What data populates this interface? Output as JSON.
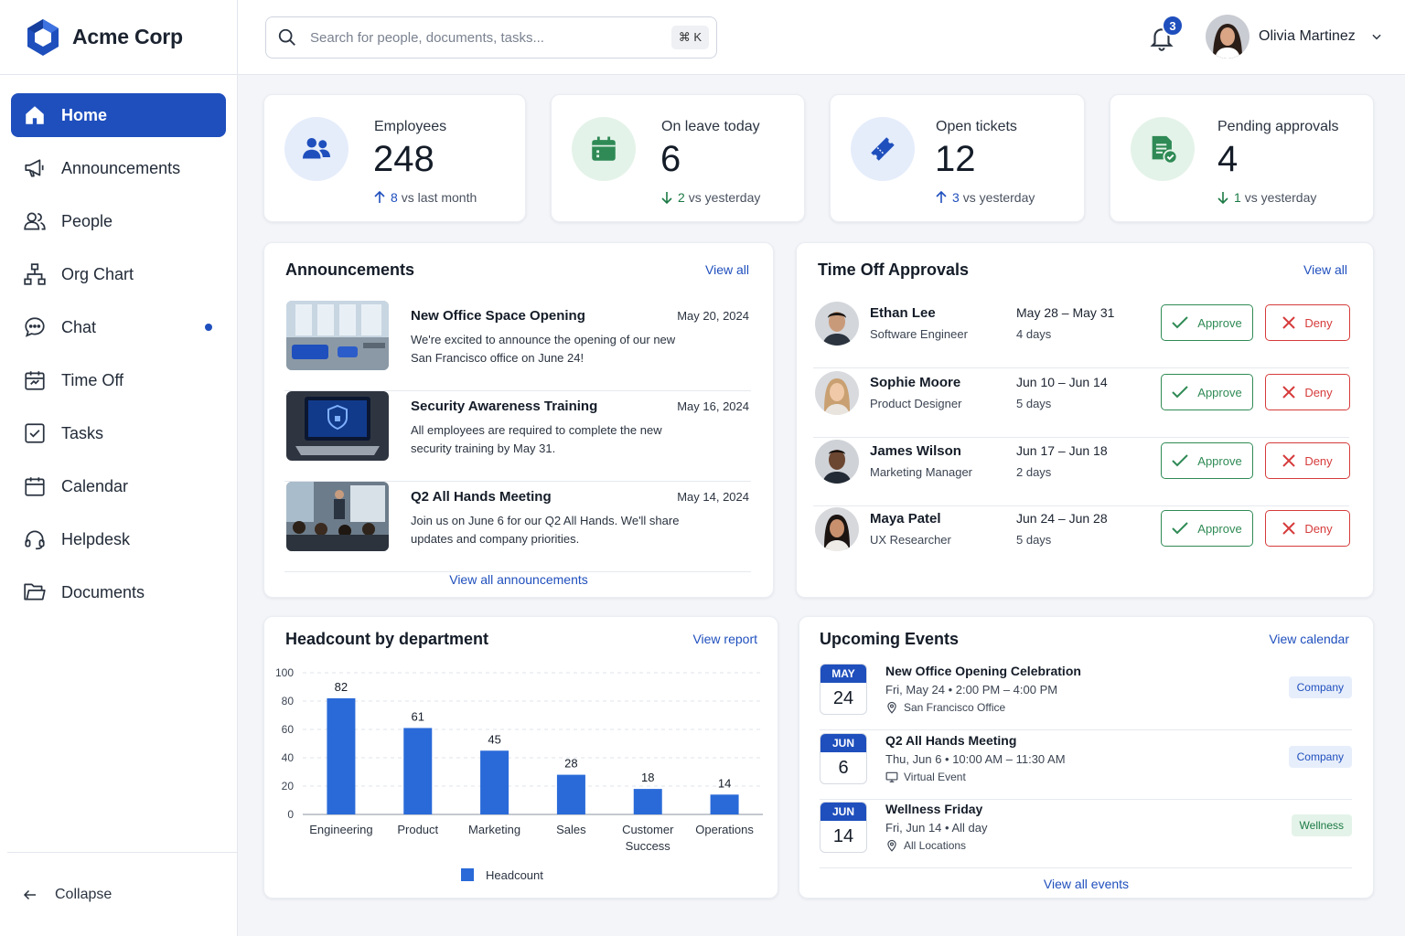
{
  "brand": {
    "name": "Acme Corp"
  },
  "nav": {
    "items": [
      {
        "label": "Home",
        "icon": "home-icon"
      },
      {
        "label": "Announcements",
        "icon": "megaphone-icon"
      },
      {
        "label": "People",
        "icon": "people-icon"
      },
      {
        "label": "Org Chart",
        "icon": "org-chart-icon"
      },
      {
        "label": "Chat",
        "icon": "chat-icon"
      },
      {
        "label": "Time Off",
        "icon": "calendar-clock-icon"
      },
      {
        "label": "Tasks",
        "icon": "checkbox-icon"
      },
      {
        "label": "Calendar",
        "icon": "calendar-icon"
      },
      {
        "label": "Helpdesk",
        "icon": "headset-icon"
      },
      {
        "label": "Documents",
        "icon": "folder-icon"
      }
    ],
    "collapse_label": "Collapse"
  },
  "search": {
    "placeholder": "Search for people, documents, tasks...",
    "shortcut": "⌘ K"
  },
  "notifications": {
    "count": "3"
  },
  "user": {
    "name": "Olivia Martinez"
  },
  "colors": {
    "accent": "#1f4fbd",
    "success": "#2f8a55",
    "danger": "#d63b3b"
  },
  "stats": [
    {
      "label": "Employees",
      "value": "248",
      "change": "8",
      "change_text": "vs last month",
      "trend": "up"
    },
    {
      "label": "On leave today",
      "value": "6",
      "change": "2",
      "change_text": "vs yesterday",
      "trend": "down"
    },
    {
      "label": "Open tickets",
      "value": "12",
      "change": "3",
      "change_text": "vs yesterday",
      "trend": "up"
    },
    {
      "label": "Pending approvals",
      "value": "4",
      "change": "1",
      "change_text": "vs yesterday",
      "trend": "down"
    }
  ],
  "announcements": {
    "title": "Announcements",
    "view_all": "View all",
    "footer_link": "View all announcements",
    "items": [
      {
        "title": "New Office Space Opening",
        "date": "May 20, 2024",
        "body": "We're excited to announce the opening of our new San Francisco office on June 24!"
      },
      {
        "title": "Security Awareness Training",
        "date": "May 16, 2024",
        "body": "All employees are required to complete the new security training by May 31."
      },
      {
        "title": "Q2 All Hands Meeting",
        "date": "May 14, 2024",
        "body": "Join us on June 6 for our Q2 All Hands. We'll share updates and company priorities."
      }
    ]
  },
  "approvals": {
    "title": "Time Off Approvals",
    "view_all": "View all",
    "approve_label": "Approve",
    "deny_label": "Deny",
    "items": [
      {
        "name": "Ethan Lee",
        "role": "Software Engineer",
        "dates": "May 28 – May 31",
        "days": "4 days"
      },
      {
        "name": "Sophie Moore",
        "role": "Product Designer",
        "dates": "Jun 10 – Jun 14",
        "days": "5 days"
      },
      {
        "name": "James Wilson",
        "role": "Marketing Manager",
        "dates": "Jun 17 – Jun 18",
        "days": "2 days"
      },
      {
        "name": "Maya Patel",
        "role": "UX Researcher",
        "dates": "Jun 24 – Jun 28",
        "days": "5 days"
      }
    ]
  },
  "headcount": {
    "title": "Headcount by department",
    "view_report": "View report"
  },
  "chart_data": {
    "type": "bar",
    "categories": [
      "Engineering",
      "Product",
      "Marketing",
      "Sales",
      "Customer Success",
      "Operations"
    ],
    "series": [
      {
        "name": "Headcount",
        "values": [
          82,
          61,
          45,
          28,
          18,
          14
        ]
      }
    ],
    "ylim": [
      0,
      100
    ],
    "yticks": [
      "0",
      "20",
      "40",
      "60",
      "80",
      "100"
    ],
    "grid": true,
    "legend": "bottom",
    "color": "#2a6ad8"
  },
  "events": {
    "title": "Upcoming Events",
    "view_calendar": "View calendar",
    "footer_link": "View all events",
    "items": [
      {
        "month": "MAY",
        "day": "24",
        "title": "New Office Opening Celebration",
        "when": "Fri, May 24 • 2:00 PM – 4:00 PM",
        "place": "San Francisco Office",
        "place_icon": "location-pin-icon",
        "tag": "Company"
      },
      {
        "month": "JUN",
        "day": "6",
        "title": "Q2 All Hands Meeting",
        "when": "Thu, Jun 6 • 10:00 AM – 11:30 AM",
        "place": "Virtual Event",
        "place_icon": "monitor-icon",
        "tag": "Company"
      },
      {
        "month": "JUN",
        "day": "14",
        "title": "Wellness Friday",
        "when": "Fri, Jun 14 • All day",
        "place": "All Locations",
        "place_icon": "location-pin-icon",
        "tag": "Wellness"
      }
    ]
  }
}
